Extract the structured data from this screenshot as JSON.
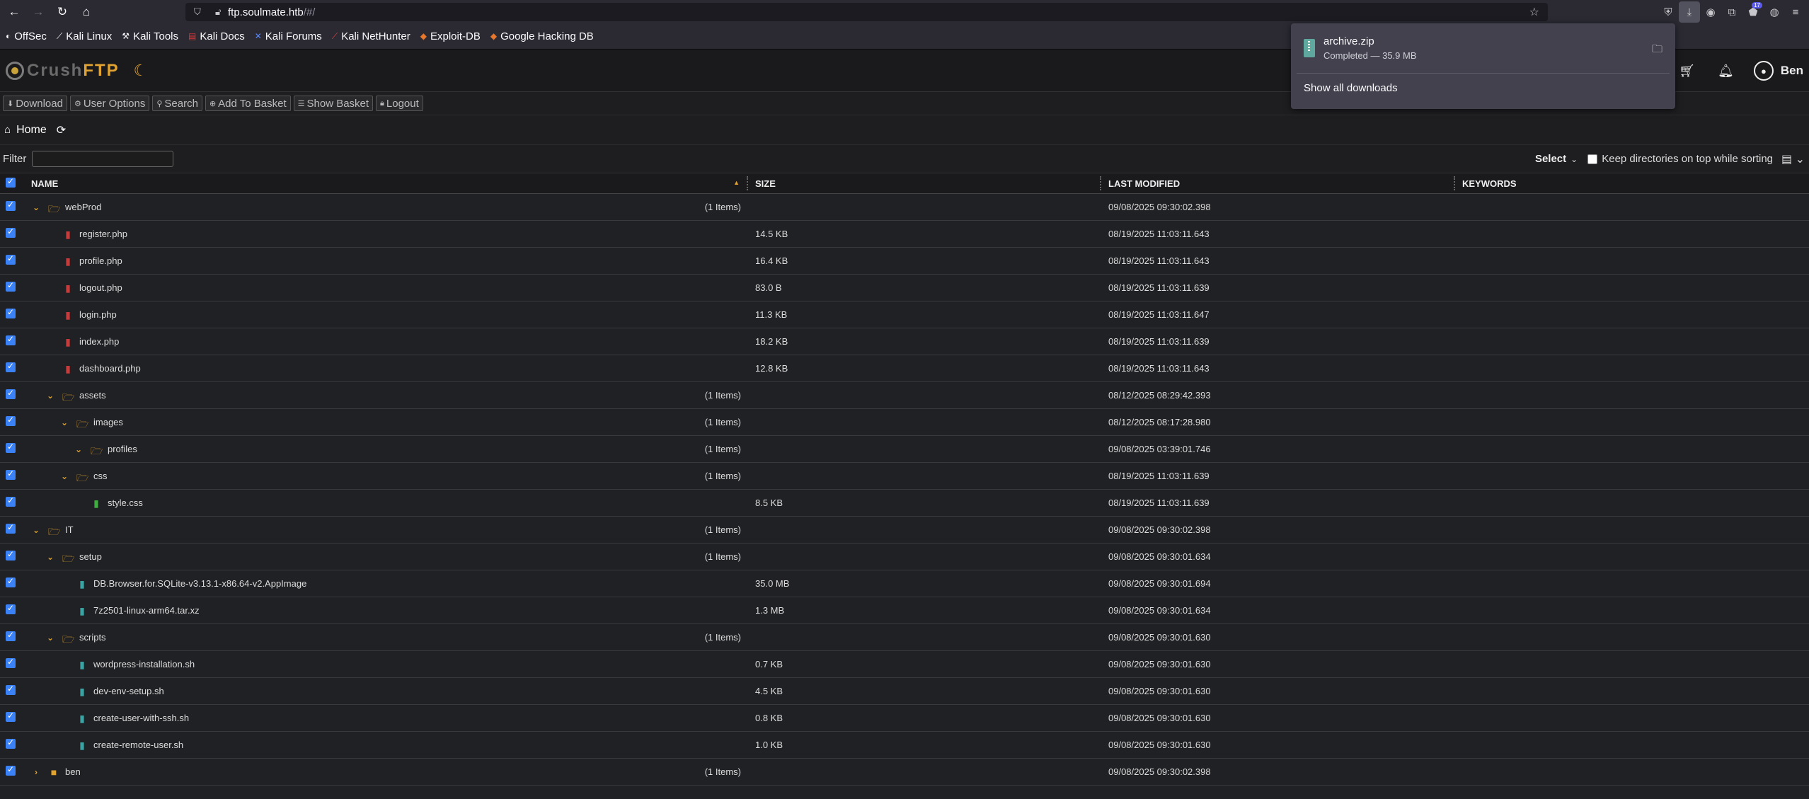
{
  "browser": {
    "url_host": "ftp.soulmate.htb",
    "url_path": "/#/",
    "extension_badge": "17"
  },
  "bookmarks": [
    {
      "label": "OffSec",
      "icon": "offsec-icon"
    },
    {
      "label": "Kali Linux",
      "icon": "kali-icon"
    },
    {
      "label": "Kali Tools",
      "icon": "kali-tools-icon"
    },
    {
      "label": "Kali Docs",
      "icon": "kali-docs-icon"
    },
    {
      "label": "Kali Forums",
      "icon": "kali-forums-icon"
    },
    {
      "label": "Kali NetHunter",
      "icon": "nethunter-icon"
    },
    {
      "label": "Exploit-DB",
      "icon": "exploit-db-icon"
    },
    {
      "label": "Google Hacking DB",
      "icon": "ghdb-icon"
    }
  ],
  "app": {
    "logo_crush": "Crush",
    "logo_ftp": "FTP",
    "user": "Ben"
  },
  "actions": {
    "download": "Download",
    "user_options": "User Options",
    "search": "Search",
    "add_to_basket": "Add To Basket",
    "show_basket": "Show Basket",
    "logout": "Logout"
  },
  "breadcrumb": {
    "home": "Home"
  },
  "filter": {
    "label": "Filter",
    "value": "",
    "select_label": "Select",
    "keep_dirs_label": "Keep directories on top while sorting"
  },
  "columns": {
    "name": "NAME",
    "size": "SIZE",
    "modified": "LAST MODIFIED",
    "keywords": "KEYWORDS"
  },
  "rows": [
    {
      "name": "webProd",
      "type": "folder",
      "depth": 0,
      "expanded": true,
      "count": "(1 Items)",
      "size": "",
      "modified": "09/08/2025 09:30:02.398"
    },
    {
      "name": "register.php",
      "type": "php",
      "depth": 1,
      "count": "",
      "size": "14.5 KB",
      "modified": "08/19/2025 11:03:11.643"
    },
    {
      "name": "profile.php",
      "type": "php",
      "depth": 1,
      "count": "",
      "size": "16.4 KB",
      "modified": "08/19/2025 11:03:11.643"
    },
    {
      "name": "logout.php",
      "type": "php",
      "depth": 1,
      "count": "",
      "size": "83.0 B",
      "modified": "08/19/2025 11:03:11.639"
    },
    {
      "name": "login.php",
      "type": "php",
      "depth": 1,
      "count": "",
      "size": "11.3 KB",
      "modified": "08/19/2025 11:03:11.647"
    },
    {
      "name": "index.php",
      "type": "php",
      "depth": 1,
      "count": "",
      "size": "18.2 KB",
      "modified": "08/19/2025 11:03:11.639"
    },
    {
      "name": "dashboard.php",
      "type": "php",
      "depth": 1,
      "count": "",
      "size": "12.8 KB",
      "modified": "08/19/2025 11:03:11.643"
    },
    {
      "name": "assets",
      "type": "folder",
      "depth": 1,
      "expanded": true,
      "count": "(1 Items)",
      "size": "",
      "modified": "08/12/2025 08:29:42.393"
    },
    {
      "name": "images",
      "type": "folder",
      "depth": 2,
      "expanded": true,
      "count": "(1 Items)",
      "size": "",
      "modified": "08/12/2025 08:17:28.980"
    },
    {
      "name": "profiles",
      "type": "folder",
      "depth": 3,
      "expanded": true,
      "count": "(1 Items)",
      "size": "",
      "modified": "09/08/2025 03:39:01.746"
    },
    {
      "name": "css",
      "type": "folder",
      "depth": 2,
      "expanded": true,
      "count": "(1 Items)",
      "size": "",
      "modified": "08/19/2025 11:03:11.639"
    },
    {
      "name": "style.css",
      "type": "css",
      "depth": 3,
      "count": "",
      "size": "8.5 KB",
      "modified": "08/19/2025 11:03:11.639"
    },
    {
      "name": "IT",
      "type": "folder",
      "depth": 0,
      "expanded": true,
      "count": "(1 Items)",
      "size": "",
      "modified": "09/08/2025 09:30:02.398"
    },
    {
      "name": "setup",
      "type": "folder",
      "depth": 1,
      "expanded": true,
      "count": "(1 Items)",
      "size": "",
      "modified": "09/08/2025 09:30:01.634"
    },
    {
      "name": "DB.Browser.for.SQLite-v3.13.1-x86.64-v2.AppImage",
      "type": "bin",
      "depth": 2,
      "count": "",
      "size": "35.0 MB",
      "modified": "09/08/2025 09:30:01.694"
    },
    {
      "name": "7z2501-linux-arm64.tar.xz",
      "type": "bin",
      "depth": 2,
      "count": "",
      "size": "1.3 MB",
      "modified": "09/08/2025 09:30:01.634"
    },
    {
      "name": "scripts",
      "type": "folder",
      "depth": 1,
      "expanded": true,
      "count": "(1 Items)",
      "size": "",
      "modified": "09/08/2025 09:30:01.630"
    },
    {
      "name": "wordpress-installation.sh",
      "type": "sh",
      "depth": 2,
      "count": "",
      "size": "0.7 KB",
      "modified": "09/08/2025 09:30:01.630"
    },
    {
      "name": "dev-env-setup.sh",
      "type": "sh",
      "depth": 2,
      "count": "",
      "size": "4.5 KB",
      "modified": "09/08/2025 09:30:01.630"
    },
    {
      "name": "create-user-with-ssh.sh",
      "type": "sh",
      "depth": 2,
      "count": "",
      "size": "0.8 KB",
      "modified": "09/08/2025 09:30:01.630"
    },
    {
      "name": "create-remote-user.sh",
      "type": "sh",
      "depth": 2,
      "count": "",
      "size": "1.0 KB",
      "modified": "09/08/2025 09:30:01.630"
    },
    {
      "name": "ben",
      "type": "folder",
      "depth": 0,
      "expanded": false,
      "count": "(1 Items)",
      "size": "",
      "modified": "09/08/2025 09:30:02.398"
    }
  ],
  "download_panel": {
    "file_name": "archive.zip",
    "status": "Completed — 35.9 MB",
    "show_all": "Show all downloads"
  }
}
